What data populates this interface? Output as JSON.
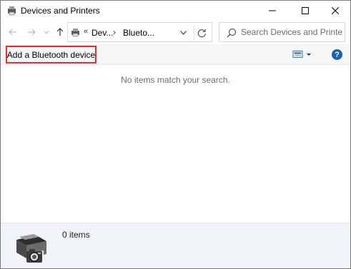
{
  "window": {
    "title": "Devices and Printers"
  },
  "navigation": {
    "breadcrumb_overflow": "«",
    "breadcrumb": [
      "Dev...",
      "Blueto..."
    ],
    "breadcrumb_separator": "›"
  },
  "search": {
    "placeholder": "Search Devices and Printers",
    "value": ""
  },
  "commandbar": {
    "add_bluetooth_label": "Add a Bluetooth device",
    "help_label": "?"
  },
  "content": {
    "empty_message": "No items match your search."
  },
  "details": {
    "item_count": "0 items"
  },
  "colors": {
    "highlight_border": "#e0312f",
    "help_blue": "#1a5fb4",
    "details_bg": "#f0f4f9"
  },
  "icons": [
    "devices-printers-icon",
    "back-arrow-icon",
    "forward-arrow-icon",
    "chevron-down-icon",
    "up-arrow-icon",
    "refresh-icon",
    "search-icon",
    "view-options-icon",
    "help-icon",
    "printer-camera-icon",
    "minimize-icon",
    "maximize-icon",
    "close-icon"
  ]
}
